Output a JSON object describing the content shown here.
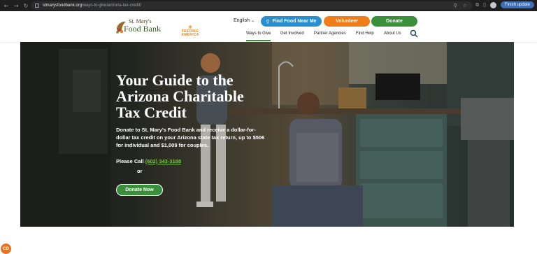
{
  "browser": {
    "url_host": "stmarysfoodbank.org",
    "url_path": "/ways-to-give/arizona-tax-credit/",
    "update_label": "Finish update"
  },
  "header": {
    "logo_line1": "St. Mary's",
    "logo_line2": "Food Bank",
    "partner_logo_line1": "FEEDING",
    "partner_logo_line2": "AMERICA",
    "language": "English",
    "buttons": {
      "find_food": "Find Food Near Me",
      "volunteer": "Volunteer",
      "donate": "Donate"
    },
    "menu": [
      "Ways to Give",
      "Get Involved",
      "Partner Agencies",
      "Find Help",
      "About Us"
    ]
  },
  "hero": {
    "title": "Your Guide to the Arizona Charitable Tax Credit",
    "subtitle": "Donate to St. Mary's Food Bank and receive a dollar-for-dollar tax credit on your Arizona state tax return, up to $506 for individual and $1,009 for couples.",
    "call_label": "Please Call",
    "phone": "(602) 343-3188",
    "or_label": "or",
    "cta": "Donate Now"
  },
  "badge": {
    "initials": "CD"
  },
  "colors": {
    "brand_green": "#3a8f3a",
    "brand_blue": "#2a8fd0",
    "brand_orange": "#f07d1a",
    "phone_link": "#7cc544"
  }
}
